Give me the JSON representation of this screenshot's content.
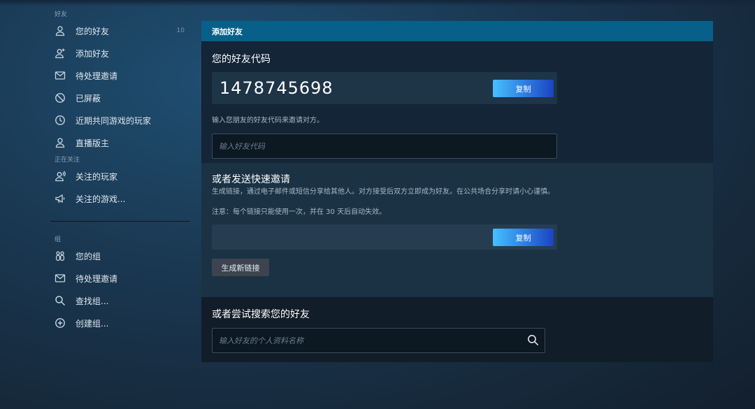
{
  "sidebar": {
    "friends_title": "好友",
    "friends_items": [
      {
        "label": "您的好友",
        "count": "10",
        "icon": "person-icon"
      },
      {
        "label": "添加好友",
        "icon": "person-add-icon"
      },
      {
        "label": "待处理邀请",
        "icon": "envelope-icon"
      },
      {
        "label": "已屏蔽",
        "icon": "blocked-icon"
      },
      {
        "label": "近期共同游戏的玩家",
        "icon": "clock-icon"
      },
      {
        "label": "直播版主",
        "icon": "person-icon"
      }
    ],
    "following_title": "正在关注",
    "following_items": [
      {
        "label": "关注的玩家",
        "icon": "person-follow-icon"
      },
      {
        "label": "关注的游戏...",
        "icon": "megaphone-icon"
      }
    ],
    "groups_title": "组",
    "groups_items": [
      {
        "label": "您的组",
        "icon": "group-icon"
      },
      {
        "label": "待处理邀请",
        "icon": "envelope-icon"
      },
      {
        "label": "查找组...",
        "icon": "search-icon"
      },
      {
        "label": "创建组...",
        "icon": "plus-circle-icon"
      }
    ]
  },
  "main": {
    "header": "添加好友",
    "code_section": {
      "heading": "您的好友代码",
      "code": "1478745698",
      "copy_label": "复制",
      "hint": "输入您朋友的好友代码来邀请对方。",
      "input_placeholder": "输入好友代码"
    },
    "invite_section": {
      "heading": "或者发送快速邀请",
      "description": "生成链接，通过电子邮件或短信分享给其他人。对方接受后双方立即成为好友。在公共场合分享时请小心谨慎。",
      "note": "注意：每个链接只能使用一次，并在 30 天后自动失效。",
      "copy_label": "复制",
      "generate_label": "生成新链接"
    },
    "search_section": {
      "heading": "或者尝试搜索您的好友",
      "input_placeholder": "输入好友的个人资料名称"
    }
  },
  "colors": {
    "header_bar": "#07608a",
    "button_gradient_start": "#47bfff",
    "button_gradient_end": "#1a44c2"
  }
}
